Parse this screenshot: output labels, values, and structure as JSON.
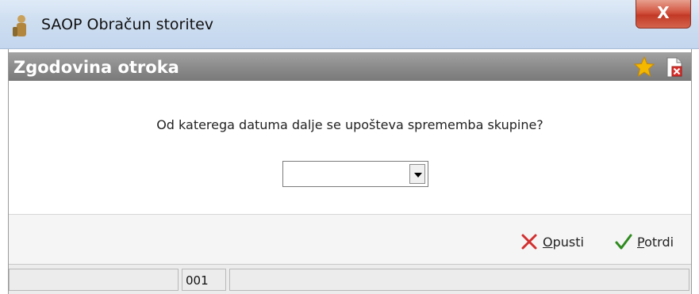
{
  "app": {
    "title": "SAOP Obračun storitev",
    "close_label": "X"
  },
  "dialog": {
    "title": "Zgodovina otroka",
    "question": "Od katerega datuma dalje se upošteva sprememba skupine?",
    "date_select": {
      "value": ""
    }
  },
  "buttons": {
    "cancel_label": "Opusti",
    "confirm_label": "Potrdi"
  },
  "statusbar": {
    "cells": [
      "",
      "001",
      ""
    ]
  },
  "colors": {
    "cancel_icon": "#d32f2f",
    "confirm_icon": "#2e8b1e",
    "star": "#f5b800"
  }
}
